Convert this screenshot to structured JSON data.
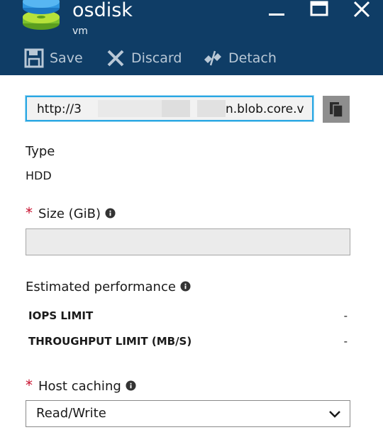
{
  "blade": {
    "title": "osdisk",
    "subtitle": "vm"
  },
  "window_controls": [
    "minimize",
    "maximize",
    "close"
  ],
  "toolbar": {
    "save_label": "Save",
    "discard_label": "Discard",
    "detach_label": "Detach"
  },
  "url_field": {
    "prefix": "http://3",
    "suffix": "n.blob.core.v"
  },
  "type_section": {
    "label": "Type",
    "value": "HDD"
  },
  "size_section": {
    "required_mark": "*",
    "label": "Size (GiB)",
    "value": ""
  },
  "performance": {
    "label": "Estimated performance",
    "rows": [
      {
        "label": "IOPS LIMIT",
        "value": "-"
      },
      {
        "label": "THROUGHPUT LIMIT (MB/S)",
        "value": "-"
      }
    ]
  },
  "host_caching": {
    "required_mark": "*",
    "label": "Host caching",
    "selected": "Read/Write"
  },
  "colors": {
    "header_bg": "#0f3d66",
    "focus_border": "#2aa7e3",
    "required": "#c8102e",
    "disabled_input": "#ebebeb"
  },
  "icons": {
    "disk": "disk-stack-icon",
    "save": "save-icon",
    "discard": "discard-icon",
    "detach": "detach-icon",
    "copy": "copy-icon",
    "info": "info-icon",
    "dropdown": "chevron-down-icon"
  }
}
